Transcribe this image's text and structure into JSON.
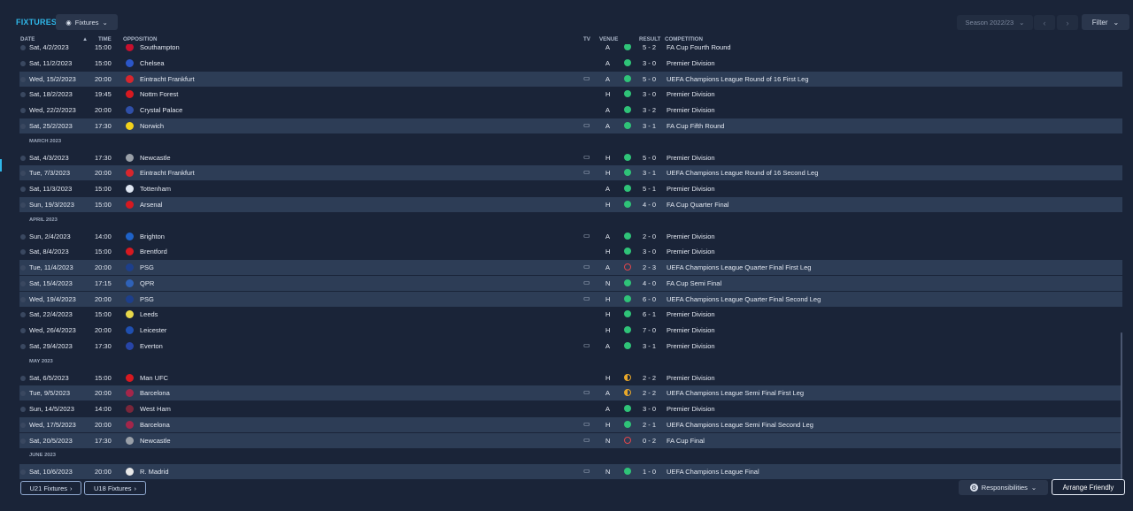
{
  "header": {
    "title": "FIXTURES",
    "view_label": "Fixtures",
    "season_label": "Season 2022/23",
    "filter_label": "Filter"
  },
  "columns": {
    "date": "DATE",
    "time": "TIME",
    "opposition": "OPPOSITION",
    "tv": "TV",
    "venue": "VENUE",
    "result": "RESULT",
    "competition": "COMPETITION"
  },
  "fixtures": [
    {
      "type": "match",
      "date": "Sat, 4/2/2023",
      "time": "15:00",
      "opp": "Southampton",
      "crest": "#c8102e",
      "tv": false,
      "venue": "A",
      "res": "win",
      "score": "5 - 2",
      "comp": "FA Cup Fourth Round",
      "alt": false
    },
    {
      "type": "match",
      "date": "Sat, 11/2/2023",
      "time": "15:00",
      "opp": "Chelsea",
      "crest": "#2b56c8",
      "tv": false,
      "venue": "A",
      "res": "win",
      "score": "3 - 0",
      "comp": "Premier Division",
      "alt": false
    },
    {
      "type": "match",
      "date": "Wed, 15/2/2023",
      "time": "20:00",
      "opp": "Eintracht Frankfurt",
      "crest": "#d8262d",
      "tv": true,
      "venue": "A",
      "res": "win",
      "score": "5 - 0",
      "comp": "UEFA Champions League Round of 16 First Leg",
      "alt": true
    },
    {
      "type": "match",
      "date": "Sat, 18/2/2023",
      "time": "19:45",
      "opp": "Nottm Forest",
      "crest": "#d71920",
      "tv": false,
      "venue": "H",
      "res": "win",
      "score": "3 - 0",
      "comp": "Premier Division",
      "alt": false
    },
    {
      "type": "match",
      "date": "Wed, 22/2/2023",
      "time": "20:00",
      "opp": "Crystal Palace",
      "crest": "#2f4fa8",
      "tv": false,
      "venue": "A",
      "res": "win",
      "score": "3 - 2",
      "comp": "Premier Division",
      "alt": false
    },
    {
      "type": "match",
      "date": "Sat, 25/2/2023",
      "time": "17:30",
      "opp": "Norwich",
      "crest": "#f2d21b",
      "tv": true,
      "venue": "A",
      "res": "win",
      "score": "3 - 1",
      "comp": "FA Cup Fifth Round",
      "alt": true
    },
    {
      "type": "month",
      "label": "MARCH 2023"
    },
    {
      "type": "match",
      "date": "Sat, 4/3/2023",
      "time": "17:30",
      "opp": "Newcastle",
      "crest": "#9aa0a8",
      "tv": true,
      "venue": "H",
      "res": "win",
      "score": "5 - 0",
      "comp": "Premier Division",
      "alt": false
    },
    {
      "type": "match",
      "date": "Tue, 7/3/2023",
      "time": "20:00",
      "opp": "Eintracht Frankfurt",
      "crest": "#d8262d",
      "tv": true,
      "venue": "H",
      "res": "win",
      "score": "3 - 1",
      "comp": "UEFA Champions League Round of 16  Second Leg",
      "alt": true
    },
    {
      "type": "match",
      "date": "Sat, 11/3/2023",
      "time": "15:00",
      "opp": "Tottenham",
      "crest": "#dfe6f2",
      "tv": false,
      "venue": "A",
      "res": "win",
      "score": "5 - 1",
      "comp": "Premier Division",
      "alt": false
    },
    {
      "type": "match",
      "date": "Sun, 19/3/2023",
      "time": "15:00",
      "opp": "Arsenal",
      "crest": "#d71920",
      "tv": false,
      "venue": "H",
      "res": "win",
      "score": "4 - 0",
      "comp": "FA Cup Quarter Final",
      "alt": true
    },
    {
      "type": "month",
      "label": "APRIL 2023"
    },
    {
      "type": "match",
      "date": "Sun, 2/4/2023",
      "time": "14:00",
      "opp": "Brighton",
      "crest": "#1e62c8",
      "tv": true,
      "venue": "A",
      "res": "win",
      "score": "2 - 0",
      "comp": "Premier Division",
      "alt": false
    },
    {
      "type": "match",
      "date": "Sat, 8/4/2023",
      "time": "15:00",
      "opp": "Brentford",
      "crest": "#d71920",
      "tv": false,
      "venue": "H",
      "res": "win",
      "score": "3 - 0",
      "comp": "Premier Division",
      "alt": false
    },
    {
      "type": "match",
      "date": "Tue, 11/4/2023",
      "time": "20:00",
      "opp": "PSG",
      "crest": "#1d3f8c",
      "tv": true,
      "venue": "A",
      "res": "loss",
      "score": "2 - 3",
      "comp": "UEFA Champions League Quarter Final First Leg",
      "alt": true
    },
    {
      "type": "match",
      "date": "Sat, 15/4/2023",
      "time": "17:15",
      "opp": "QPR",
      "crest": "#2f62b8",
      "tv": true,
      "venue": "N",
      "res": "win",
      "score": "4 - 0",
      "comp": "FA Cup Semi Final",
      "alt": true
    },
    {
      "type": "match",
      "date": "Wed, 19/4/2023",
      "time": "20:00",
      "opp": "PSG",
      "crest": "#1d3f8c",
      "tv": true,
      "venue": "H",
      "res": "win",
      "score": "6 - 0",
      "comp": "UEFA Champions League Quarter Final Second Leg",
      "alt": true
    },
    {
      "type": "match",
      "date": "Sat, 22/4/2023",
      "time": "15:00",
      "opp": "Leeds",
      "crest": "#e8d84a",
      "tv": false,
      "venue": "H",
      "res": "win",
      "score": "6 - 1",
      "comp": "Premier Division",
      "alt": false
    },
    {
      "type": "match",
      "date": "Wed, 26/4/2023",
      "time": "20:00",
      "opp": "Leicester",
      "crest": "#1f4fb0",
      "tv": false,
      "venue": "H",
      "res": "win",
      "score": "7 - 0",
      "comp": "Premier Division",
      "alt": false
    },
    {
      "type": "match",
      "date": "Sat, 29/4/2023",
      "time": "17:30",
      "opp": "Everton",
      "crest": "#2745a8",
      "tv": true,
      "venue": "A",
      "res": "win",
      "score": "3 - 1",
      "comp": "Premier Division",
      "alt": false
    },
    {
      "type": "month",
      "label": "MAY 2023"
    },
    {
      "type": "match",
      "date": "Sat, 6/5/2023",
      "time": "15:00",
      "opp": "Man UFC",
      "crest": "#d71920",
      "tv": false,
      "venue": "H",
      "res": "draw",
      "score": "2 - 2",
      "comp": "Premier Division",
      "alt": false
    },
    {
      "type": "match",
      "date": "Tue, 9/5/2023",
      "time": "20:00",
      "opp": "Barcelona",
      "crest": "#a4264a",
      "tv": true,
      "venue": "A",
      "res": "draw",
      "score": "2 - 2",
      "comp": "UEFA Champions League Semi Final First Leg",
      "alt": true
    },
    {
      "type": "match",
      "date": "Sun, 14/5/2023",
      "time": "14:00",
      "opp": "West Ham",
      "crest": "#7a263a",
      "tv": false,
      "venue": "A",
      "res": "win",
      "score": "3 - 0",
      "comp": "Premier Division",
      "alt": false
    },
    {
      "type": "match",
      "date": "Wed, 17/5/2023",
      "time": "20:00",
      "opp": "Barcelona",
      "crest": "#a4264a",
      "tv": true,
      "venue": "H",
      "res": "win",
      "score": "2 - 1",
      "comp": "UEFA Champions League Semi Final Second Leg",
      "alt": true
    },
    {
      "type": "match",
      "date": "Sat, 20/5/2023",
      "time": "17:30",
      "opp": "Newcastle",
      "crest": "#9aa0a8",
      "tv": true,
      "venue": "N",
      "res": "loss",
      "score": "0 - 2",
      "comp": "FA Cup Final",
      "alt": true
    },
    {
      "type": "month",
      "label": "JUNE 2023"
    },
    {
      "type": "match",
      "date": "Sat, 10/6/2023",
      "time": "20:00",
      "opp": "R. Madrid",
      "crest": "#e8e8e8",
      "tv": true,
      "venue": "N",
      "res": "win",
      "score": "1 - 0",
      "comp": "UEFA Champions League Final",
      "alt": true
    }
  ],
  "footer": {
    "u21_label": "U21 Fixtures",
    "u18_label": "U18 Fixtures",
    "responsibilities_label": "Responsibilities",
    "arrange_label": "Arrange Friendly"
  },
  "colors": {
    "accent": "#2fb7e9",
    "win": "#2fc378",
    "loss": "#e0464b",
    "draw": "#e9a82a"
  }
}
